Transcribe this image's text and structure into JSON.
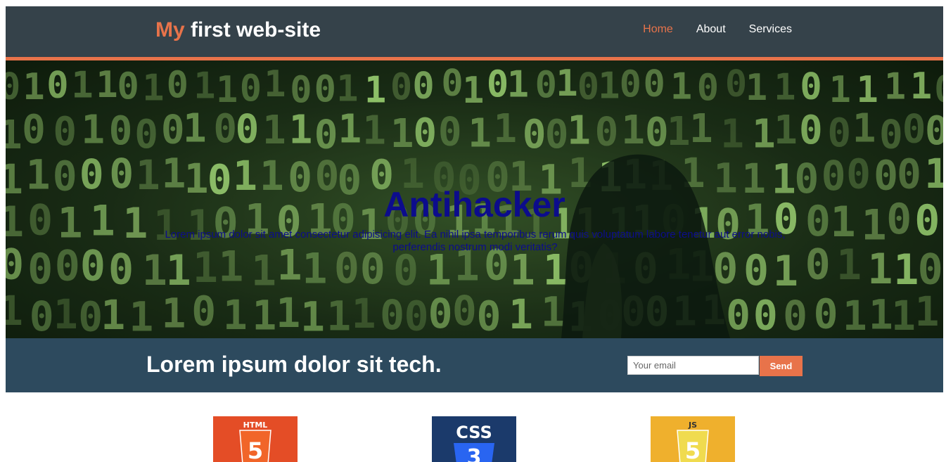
{
  "header": {
    "logo_accent": "My",
    "logo_rest": " first web-site",
    "nav": [
      {
        "label": "Home",
        "active": true
      },
      {
        "label": "About",
        "active": false
      },
      {
        "label": "Services",
        "active": false
      }
    ]
  },
  "hero": {
    "title": "Antihacker",
    "text": "Lorem ipsum dolor sit amet consectetur adipisicing elit. Ea nihil ipsa temporibus rerum quis voluptatum labore tenetur aut error nobis, perferendis nostrum modi veritatis?"
  },
  "newsletter": {
    "heading": "Lorem ipsum dolor sit tech.",
    "email_placeholder": "Your email",
    "send_label": "Send"
  },
  "tech": [
    {
      "name": "HTML",
      "number": "5",
      "color": "#e44d26",
      "shield": "#f16529"
    },
    {
      "name": "CSS",
      "number": "3",
      "color": "#1b3a6b",
      "shield": "#2965f1"
    },
    {
      "name": "JS",
      "number": "5",
      "color": "#efb02d",
      "shield": "#f0db4f"
    }
  ],
  "colors": {
    "header_bg": "#35424a",
    "accent": "#e8734a",
    "newsletter_bg": "#2d4a5e",
    "hero_text": "#0c0c8c"
  }
}
